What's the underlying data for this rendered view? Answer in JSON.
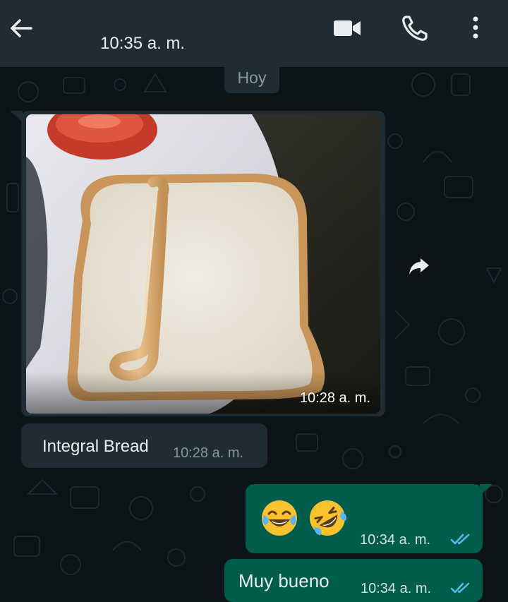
{
  "header": {
    "time": "10:35 a. m.",
    "back_icon": "arrow-left-icon",
    "video_icon": "video-camera-icon",
    "call_icon": "phone-icon",
    "menu_icon": "vertical-dots-icon"
  },
  "day_label": "Hoy",
  "messages": [
    {
      "direction": "incoming",
      "type": "image",
      "image_subject": "photo of a slice of white bread with a line of mustard drawn on it",
      "time": "10:28 a. m."
    },
    {
      "direction": "incoming",
      "type": "text",
      "text": "Integral Bread",
      "time": "10:28 a. m."
    },
    {
      "direction": "outgoing",
      "type": "emoji",
      "emojis": [
        "😂",
        "🤣"
      ],
      "time": "10:34 a. m.",
      "status": "read"
    },
    {
      "direction": "outgoing",
      "type": "text",
      "text": "Muy bueno",
      "time": "10:34 a. m.",
      "status": "read"
    }
  ],
  "forward_icon": "share-forward-icon",
  "colors": {
    "header": "#1f2c34",
    "background": "#0d1418",
    "incoming_bubble": "#1f2c34",
    "outgoing_bubble": "#005c4b",
    "read_ticks": "#53bdeb"
  }
}
